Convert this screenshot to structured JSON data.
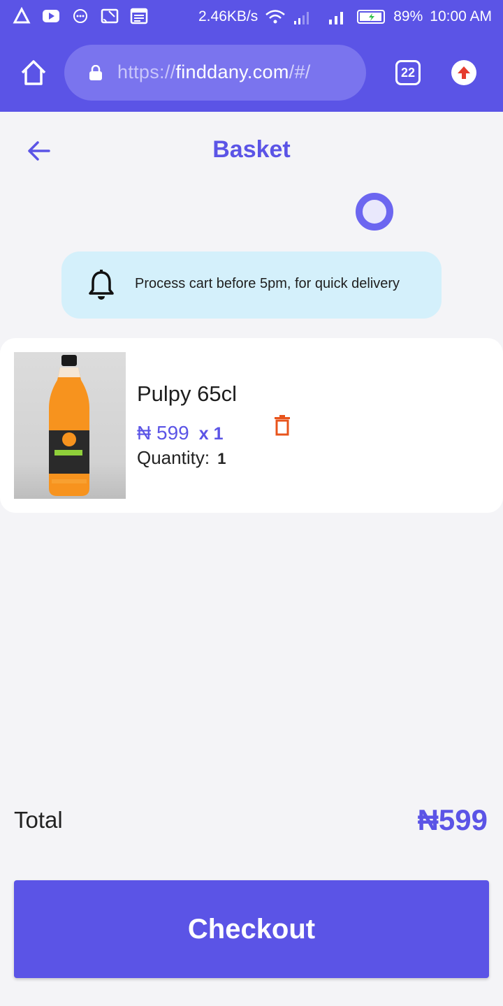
{
  "status_bar": {
    "net_speed": "2.46KB/s",
    "battery": "89%",
    "time": "10:00 AM",
    "icons": [
      "app-icon",
      "youtube-icon",
      "chat-icon",
      "cast-icon",
      "news-icon",
      "wifi-icon",
      "signal-icon",
      "battery-icon"
    ]
  },
  "browser": {
    "url_scheme": "https://",
    "url_domain": "finddany.com",
    "url_path": "/#/",
    "tab_count": "22"
  },
  "header": {
    "title": "Basket"
  },
  "notice": {
    "text": "Process cart before 5pm, for quick delivery"
  },
  "cart": {
    "items": [
      {
        "name": "Pulpy 65cl",
        "price": "₦ 599",
        "multiplier": "x 1",
        "quantity_label": "Quantity:",
        "quantity": "1"
      }
    ]
  },
  "summary": {
    "total_label": "Total",
    "total_value": "₦599"
  },
  "actions": {
    "checkout_label": "Checkout"
  },
  "colors": {
    "accent": "#5b54e6",
    "notice_bg": "#d4f0fb",
    "delete": "#e8541c"
  }
}
